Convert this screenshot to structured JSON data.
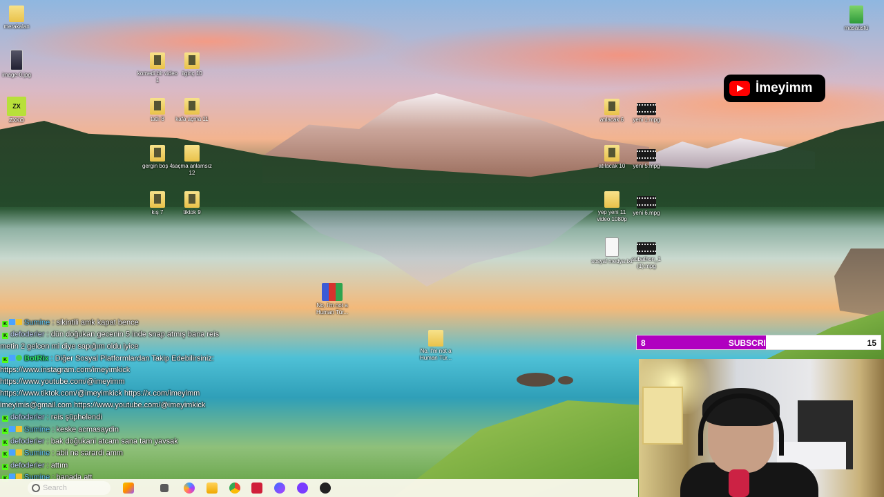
{
  "desktop": {
    "icons": [
      {
        "id": "merakalan",
        "label": "merakalan",
        "type": "folder"
      },
      {
        "id": "image0",
        "label": "image-0.jpg",
        "type": "image"
      },
      {
        "id": "zxko",
        "label": "ZXKO",
        "type": "zx"
      },
      {
        "id": "masaustu",
        "label": "masaüstü",
        "type": "green"
      },
      {
        "id": "komedi",
        "label": "komedi bir video 1",
        "type": "folder-pic"
      },
      {
        "id": "ilginc",
        "label": "ilginç 10",
        "type": "folder-pic"
      },
      {
        "id": "tatli",
        "label": "tatlı 8",
        "type": "folder-pic"
      },
      {
        "id": "kafa",
        "label": "kafa açma 11",
        "type": "folder-pic"
      },
      {
        "id": "gergin",
        "label": "gergin boş 4",
        "type": "folder-pic"
      },
      {
        "id": "sacma",
        "label": "saçma anlamsız 12",
        "type": "folder"
      },
      {
        "id": "kis",
        "label": "kış 7",
        "type": "folder-pic"
      },
      {
        "id": "tiktok9",
        "label": "tiktok 9",
        "type": "folder-pic"
      },
      {
        "id": "atilacak6",
        "label": "atılacak 6",
        "type": "folder-pic"
      },
      {
        "id": "yeni1",
        "label": "yeni 1.mpg",
        "type": "video"
      },
      {
        "id": "atilacak10",
        "label": "atılacak 10",
        "type": "folder-pic"
      },
      {
        "id": "yeni5",
        "label": "yeni 5.mpg",
        "type": "video"
      },
      {
        "id": "yepyeni",
        "label": "yep yeni 11 video 1080p",
        "type": "folder"
      },
      {
        "id": "yeni6",
        "label": "yeni 6.mpg",
        "type": "video"
      },
      {
        "id": "sosyal",
        "label": "sosyal medya.txt",
        "type": "doc"
      },
      {
        "id": "subathon",
        "label": "subathon_1 (1).mpg",
        "type": "video"
      },
      {
        "id": "rar",
        "label": "No, I'm not a Human Tür...",
        "type": "rar"
      },
      {
        "id": "nohuman",
        "label": "No, I'm not a Human Tür...",
        "type": "folder"
      }
    ]
  },
  "overlay": {
    "channel_name": "İmeyimm",
    "subs_current": "8",
    "subs_label": "SUBSCRIBERS",
    "subs_goal": "15",
    "subs_progress": 0.53
  },
  "chat": [
    {
      "user": "Sumine",
      "cls": "u-sumine",
      "badges": [
        "k",
        "b",
        "y"
      ],
      "msg": " : sikintili amk kapat bence"
    },
    {
      "user": "defoderler",
      "cls": "u-defo",
      "badges": [
        "k"
      ],
      "msg": " : dün doğukan gecenin 5 inde snap atmış bana reis"
    },
    {
      "user": "",
      "cls": "",
      "badges": [],
      "msg": "metin 2 gelcen mi diye sapığım oldu iyice"
    },
    {
      "user": "BotRix",
      "cls": "u-bot",
      "badges": [
        "k",
        "b",
        "c"
      ],
      "msg": " : Diğer Sosyal Platformlardan Takip Edebilirsiniz:"
    },
    {
      "user": "",
      "cls": "",
      "badges": [],
      "msg": "https://www.instagram.com/imeyimkick"
    },
    {
      "user": "",
      "cls": "",
      "badges": [],
      "msg": "https://www.youtube.com/@imeyimm"
    },
    {
      "user": "",
      "cls": "",
      "badges": [],
      "msg": "https://www.tiktok.com/@imeyimkick https://x.com/imeyimm"
    },
    {
      "user": "",
      "cls": "",
      "badges": [],
      "msg": "imeyimis@gmail.com https://www.youtube.com/@imeyimkick"
    },
    {
      "user": "defoderler",
      "cls": "u-defo",
      "badges": [
        "k"
      ],
      "msg": " : reis şüphelendi"
    },
    {
      "user": "Sumine",
      "cls": "u-sumine",
      "badges": [
        "k",
        "b",
        "y"
      ],
      "msg": " : keske acmasaydin"
    },
    {
      "user": "defoderler",
      "cls": "u-defo",
      "badges": [
        "k"
      ],
      "msg": " : bak doğukani atcam sana tam yavsak"
    },
    {
      "user": "Sumine",
      "cls": "u-sumine",
      "badges": [
        "k",
        "b",
        "y"
      ],
      "msg": " : abii ne sarardi amm"
    },
    {
      "user": "defoderler",
      "cls": "u-defo",
      "badges": [
        "k"
      ],
      "msg": " : attım"
    },
    {
      "user": "Sumine",
      "cls": "u-sumine",
      "badges": [
        "k",
        "b",
        "y"
      ],
      "msg": " : banada att"
    }
  ],
  "taskbar": {
    "search_placeholder": "Search",
    "items": [
      "sparkle-icon",
      "task-view-icon",
      "copilot-icon",
      "file-explorer-icon",
      "chrome-icon",
      "winrar-icon",
      "discord-icon",
      "obs-icon",
      "app-icon"
    ]
  }
}
